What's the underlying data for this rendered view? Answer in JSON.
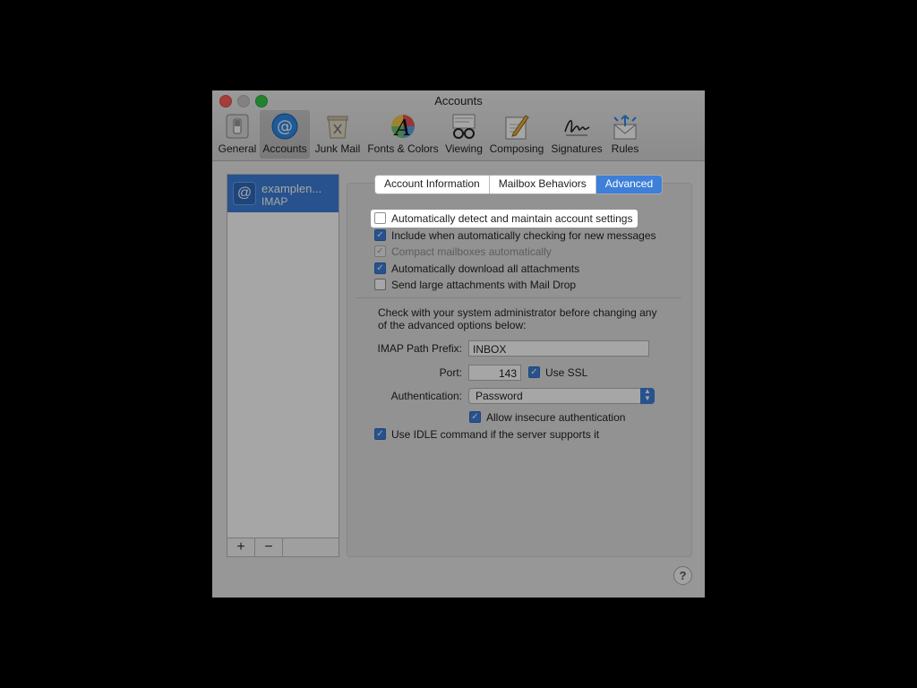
{
  "window": {
    "title": "Accounts"
  },
  "toolbar": [
    {
      "label": "General",
      "icon": "switch-icon"
    },
    {
      "label": "Accounts",
      "icon": "at-icon",
      "selected": true
    },
    {
      "label": "Junk Mail",
      "icon": "trash-icon"
    },
    {
      "label": "Fonts & Colors",
      "icon": "fonts-colors-icon"
    },
    {
      "label": "Viewing",
      "icon": "glasses-icon"
    },
    {
      "label": "Composing",
      "icon": "pencil-icon"
    },
    {
      "label": "Signatures",
      "icon": "signature-icon"
    },
    {
      "label": "Rules",
      "icon": "rules-icon"
    }
  ],
  "sidebar": {
    "account": {
      "name": "examplen...",
      "type": "IMAP",
      "icon_glyph": "@"
    },
    "add_label": "+",
    "remove_label": "−"
  },
  "tabs": [
    {
      "label": "Account Information"
    },
    {
      "label": "Mailbox Behaviors"
    },
    {
      "label": "Advanced",
      "active": true
    }
  ],
  "options": {
    "auto_detect": {
      "label": "Automatically detect and maintain account settings",
      "checked": false
    },
    "include_check": {
      "label": "Include when automatically checking for new messages",
      "checked": true
    },
    "compact": {
      "label": "Compact mailboxes automatically",
      "checked": true,
      "disabled": true
    },
    "download_attachments": {
      "label": "Automatically download all attachments",
      "checked": true
    },
    "mail_drop": {
      "label": "Send large attachments with Mail Drop",
      "checked": false
    }
  },
  "advanced": {
    "note": "Check with your system administrator before changing any of the advanced options below:",
    "imap_prefix_label": "IMAP Path Prefix:",
    "imap_prefix_value": "INBOX",
    "port_label": "Port:",
    "port_value": "143",
    "ssl_label": "Use SSL",
    "auth_label": "Authentication:",
    "auth_value": "Password",
    "insecure_label": "Allow insecure authentication",
    "idle_label": "Use IDLE command if the server supports it"
  },
  "help_label": "?",
  "colors": {
    "accent": "#3d7fd9",
    "close": "#fc605c",
    "zoom": "#34c84a"
  }
}
